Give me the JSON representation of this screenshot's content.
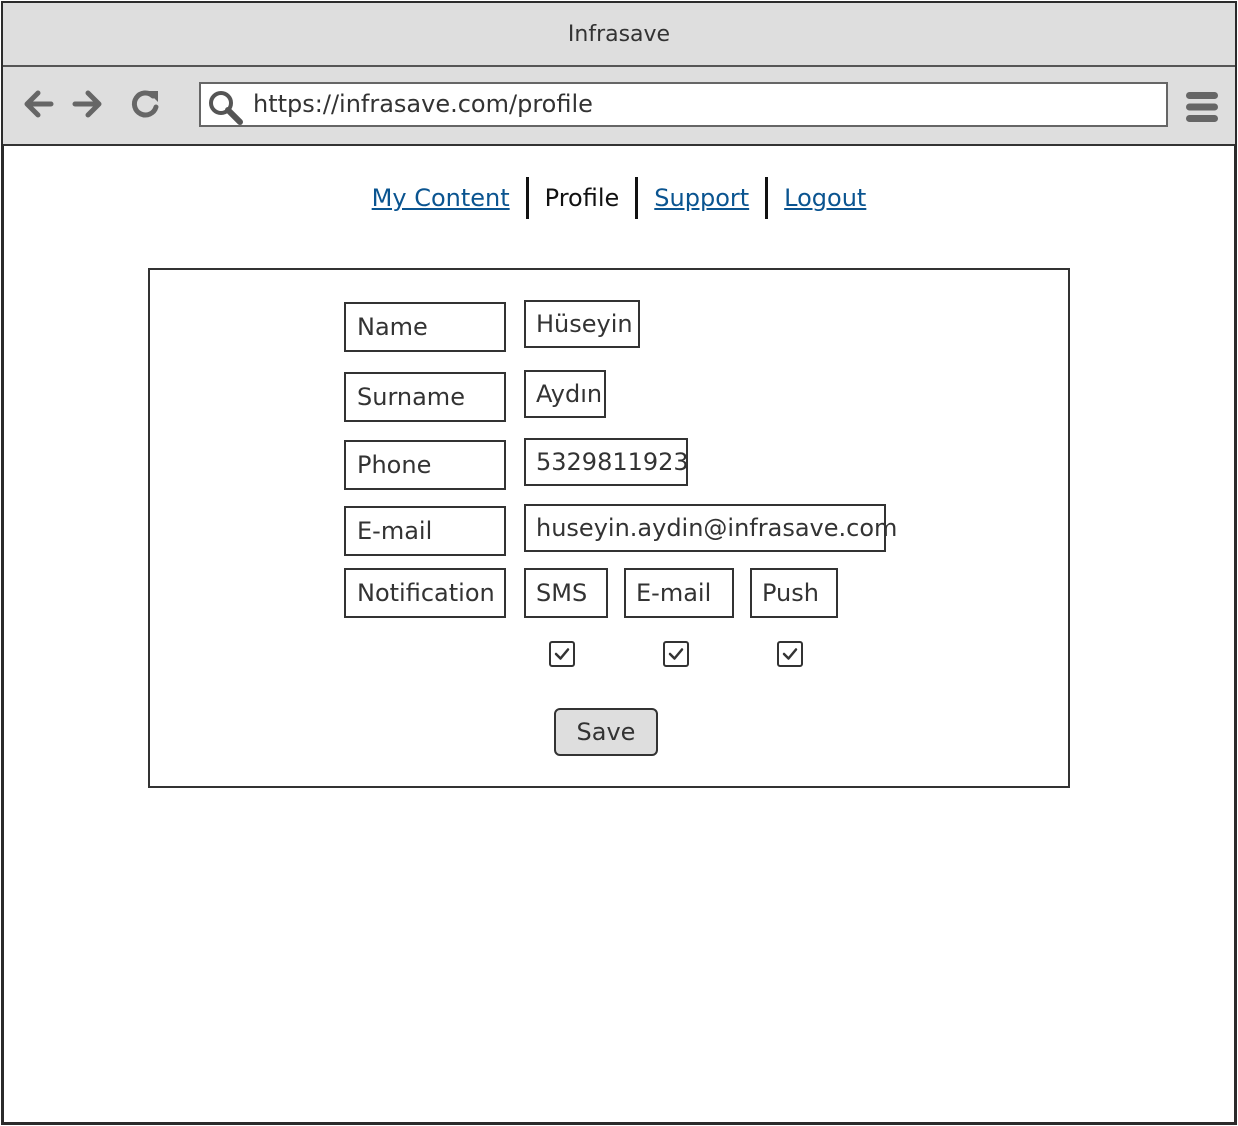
{
  "window": {
    "title": "Infrasave"
  },
  "browser": {
    "url": "https://infrasave.com/profile",
    "icons": [
      "back-arrow-icon",
      "forward-arrow-icon",
      "reload-icon",
      "search-icon",
      "hamburger-menu-icon"
    ]
  },
  "nav": {
    "items": [
      {
        "label": "My Content",
        "current": false
      },
      {
        "label": "Profile",
        "current": true
      },
      {
        "label": "Support",
        "current": false
      },
      {
        "label": "Logout",
        "current": false
      }
    ]
  },
  "form": {
    "name_label": "Name",
    "name_value": "Hüseyin",
    "surname_label": "Surname",
    "surname_value": "Aydın",
    "phone_label": "Phone",
    "phone_value": "5329811923",
    "email_label": "E-mail",
    "email_value": "huseyin.aydin@infrasave.com",
    "notification_label": "Notification",
    "notification_options": [
      {
        "label": "SMS",
        "checked": true
      },
      {
        "label": "E-mail",
        "checked": true
      },
      {
        "label": "Push",
        "checked": true
      }
    ],
    "save_label": "Save"
  },
  "colors": {
    "link": "#0a5490",
    "chrome_bg": "#dedede",
    "border": "#333333"
  }
}
